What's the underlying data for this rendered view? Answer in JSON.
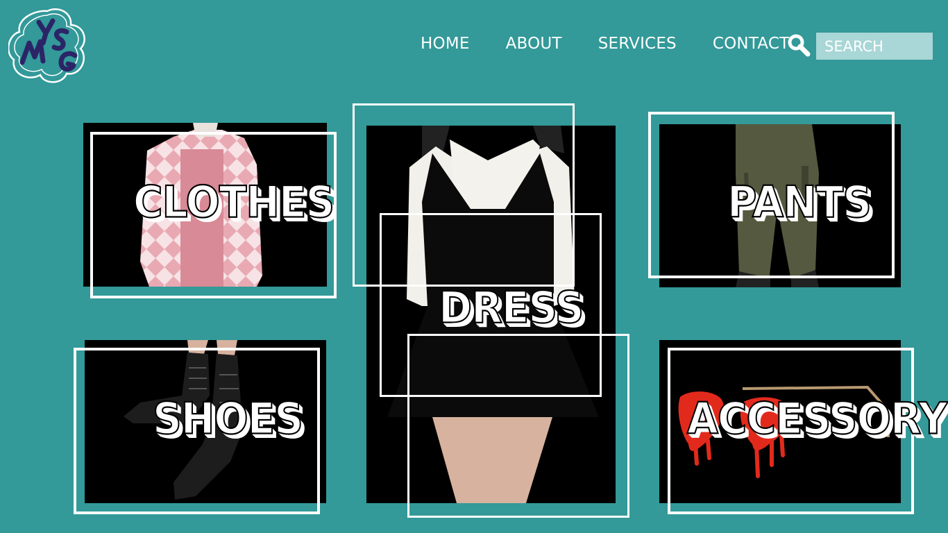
{
  "brand": {
    "logo_text": "MYSG"
  },
  "nav": {
    "items": [
      "HOME",
      "ABOUT",
      "SERVICES",
      "CONTACT"
    ]
  },
  "search": {
    "placeholder": "SEARCH"
  },
  "categories": {
    "clothes": "CLOTHES",
    "dress": "DRESS",
    "pants": "PANTS",
    "shoes": "SHOES",
    "accessory": "ACCESSORY"
  },
  "colors": {
    "background": "#339999",
    "search_bg": "#a9d6d6",
    "logo_ink": "#2b2567"
  }
}
